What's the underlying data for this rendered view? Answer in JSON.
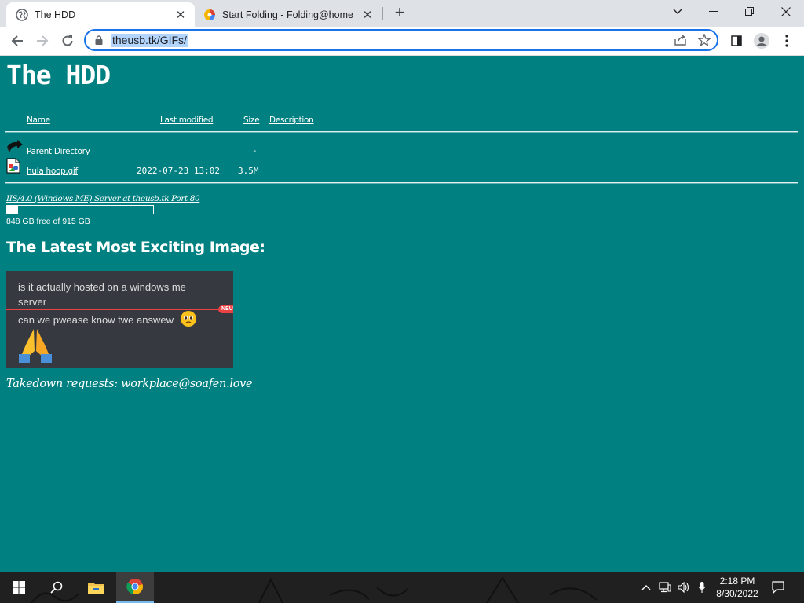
{
  "browser": {
    "tabs": [
      {
        "title": "The HDD",
        "active": true,
        "icon": "globe-icon"
      },
      {
        "title": "Start Folding - Folding@home",
        "active": false,
        "icon": "folding-at-home-icon"
      }
    ],
    "url": "theusb.tk/GIFs/"
  },
  "page": {
    "title": "The HDD",
    "listing": {
      "headers": {
        "name": "Name",
        "last_modified": "Last modified",
        "size": "Size",
        "description": "Description"
      },
      "parent": {
        "name": "Parent Directory",
        "size": "-"
      },
      "files": [
        {
          "name": "hula hoop.gif",
          "last_modified": "2022-07-23 13:02",
          "size": "3.5M"
        }
      ]
    },
    "server_signature": "IIS/4.0 (Windows ME) Server at theusb.tk Port 80",
    "disk": {
      "free_text": "848 GB free of 915 GB",
      "used_fraction": 0.073
    },
    "latest_heading": "The Latest Most Exciting Image:",
    "image": {
      "line1": "is it actually hosted on a windows me server",
      "badge": "NEU",
      "line2": "can we pwease know twe answew"
    },
    "takedown": "Takedown requests: workplace@soafen.love"
  },
  "taskbar": {
    "time": "2:18 PM",
    "date": "8/30/2022"
  }
}
